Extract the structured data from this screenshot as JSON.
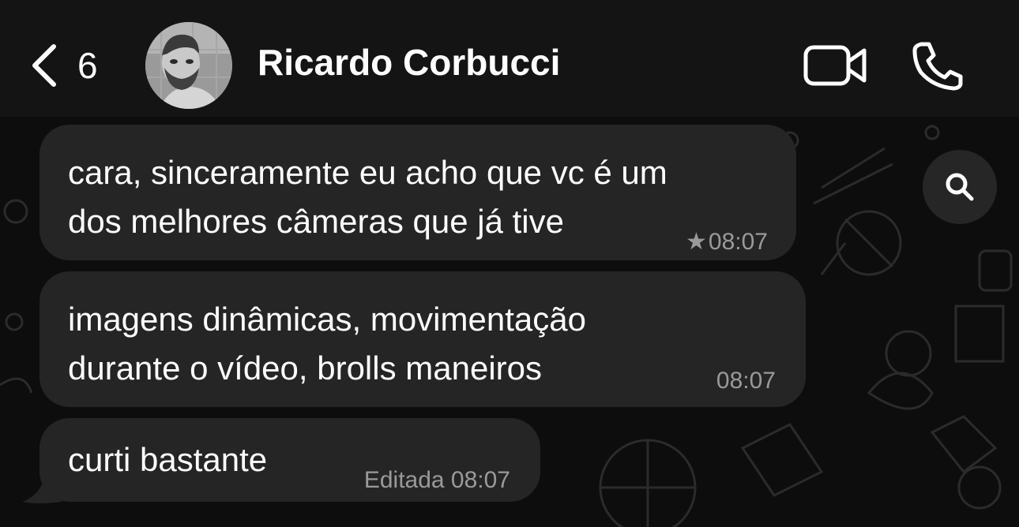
{
  "header": {
    "back_count": "6",
    "contact_name": "Ricardo Corbucci",
    "icons": {
      "back": "chevron-left-icon",
      "video": "video-camera-icon",
      "phone": "phone-icon"
    }
  },
  "messages": [
    {
      "line1": "cara, sinceramente eu acho que vc é um",
      "line2": "dos melhores câmeras que já tive",
      "time": "08:07",
      "starred": true,
      "edited_label": ""
    },
    {
      "line1": "imagens dinâmicas, movimentação",
      "line2": "durante o vídeo, brolls maneiros",
      "time": "08:07",
      "starred": false,
      "edited_label": ""
    },
    {
      "line1": "curti bastante",
      "line2": "",
      "time": "08:07",
      "starred": false,
      "edited_label": "Editada"
    }
  ],
  "search": {
    "icon": "search-icon"
  },
  "colors": {
    "header_bg": "#141414",
    "chat_bg": "#0d0d0d",
    "bubble_bg": "#252525",
    "text": "#ffffff",
    "meta_text": "#9a9a9a"
  }
}
